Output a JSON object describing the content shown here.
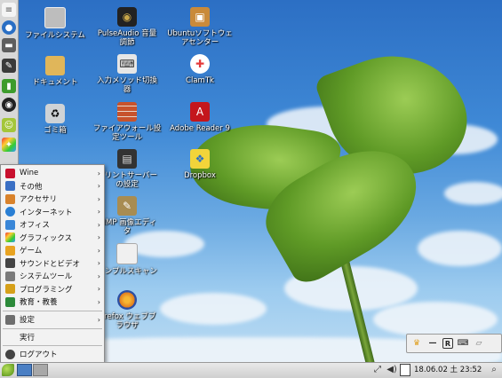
{
  "desktop_icons": [
    {
      "label": "ファイルシステム",
      "icon": "drive-icon",
      "color": "#9a9a9a"
    },
    {
      "label": "ドキュメント",
      "icon": "folder-icon",
      "color": "#e0b65a"
    },
    {
      "label": "ゴミ箱",
      "icon": "trash-icon",
      "color": "#cfd3d6"
    },
    {
      "label": "PulseAudio 音量\n調節",
      "icon": "speaker-icon",
      "color": "#c9a74a"
    },
    {
      "label": "入力メソッド切換\n器",
      "icon": "keyboard-icon",
      "color": "#cfcfcf"
    },
    {
      "label": "ファイアウォール設\n定ツール",
      "icon": "firewall-icon",
      "color": "#c7532c"
    },
    {
      "label": "プリントサーバー\nの設定",
      "icon": "printer-icon",
      "color": "#333333"
    },
    {
      "label": "GIMP 画像エディ\nタ",
      "icon": "gimp-icon",
      "color": "#a88c52"
    },
    {
      "label": "シンプルスキャン",
      "icon": "scanner-icon",
      "color": "#e8e8e8"
    },
    {
      "label": "Firefox ウェブブ\nラウザ",
      "icon": "firefox-icon",
      "color": "#e07b1e"
    },
    {
      "label": "Ubuntuソフトウェ\nアセンター",
      "icon": "software-center-icon",
      "color": "#c98a3a"
    },
    {
      "label": "ClamTk",
      "icon": "clamtk-icon",
      "color": "#e43a3a"
    },
    {
      "label": "Adobe Reader 9",
      "icon": "adobe-reader-icon",
      "color": "#c4161c"
    },
    {
      "label": "Dropbox",
      "icon": "dropbox-icon",
      "color": "#f2d43a"
    }
  ],
  "menu": {
    "items": [
      {
        "label": "Wine",
        "icon": "wine-icon",
        "color": "#c8102e",
        "submenu": true
      },
      {
        "label": "その他",
        "icon": "other-icon",
        "color": "#3a6fc4",
        "submenu": true
      },
      {
        "label": "アクセサリ",
        "icon": "accessories-icon",
        "color": "#d9822b",
        "submenu": true
      },
      {
        "label": "インターネット",
        "icon": "internet-icon",
        "color": "#2a7fd4",
        "submenu": true
      },
      {
        "label": "オフィス",
        "icon": "office-icon",
        "color": "#3a87d8",
        "submenu": true
      },
      {
        "label": "グラフィックス",
        "icon": "graphics-icon",
        "color": "#e04e9a",
        "submenu": true
      },
      {
        "label": "ゲーム",
        "icon": "games-icon",
        "color": "#e8a321",
        "submenu": true
      },
      {
        "label": "サウンドとビデオ",
        "icon": "sound-video-icon",
        "color": "#444444",
        "submenu": true
      },
      {
        "label": "システムツール",
        "icon": "system-tools-icon",
        "color": "#7a7a7a",
        "submenu": true
      },
      {
        "label": "プログラミング",
        "icon": "programming-icon",
        "color": "#d6a019",
        "submenu": true
      },
      {
        "label": "教育・教養",
        "icon": "education-icon",
        "color": "#2c8a3a",
        "submenu": true
      }
    ],
    "settings": {
      "label": "設定",
      "icon": "settings-icon",
      "color": "#6e6e6e"
    },
    "run": {
      "label": "実行"
    },
    "logout": {
      "label": "ログアウト",
      "icon": "logout-icon",
      "color": "#444444"
    }
  },
  "panel": {
    "clock": "18.06.02 土 23:52"
  },
  "im_toolbar": {
    "items": [
      "crown-icon",
      "minus-icon",
      "R",
      "keyboard-icon",
      "eraser-icon"
    ]
  }
}
